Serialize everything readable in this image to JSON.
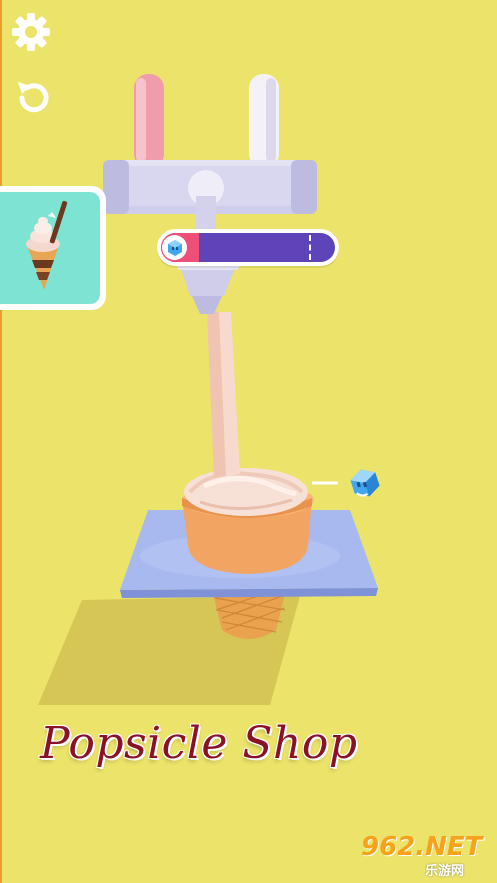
{
  "title": "Popsicle Shop",
  "hud": {
    "settings_icon": "gear-icon",
    "restart_icon": "restart-icon",
    "target_icon": "ice-cream-cone-icon",
    "fill_progress": 0.22,
    "target_marker": 0.85,
    "currency_icon": "ice-cube-icon"
  },
  "watermark": {
    "brand": "962",
    "tld": ".NET",
    "sub": "乐游网"
  },
  "colors": {
    "background": "#ece36a",
    "progress_fill": "#ee4f78",
    "progress_track": "#5e44b8",
    "target_card": "#7de4d3",
    "title_text": "#8a1228"
  }
}
